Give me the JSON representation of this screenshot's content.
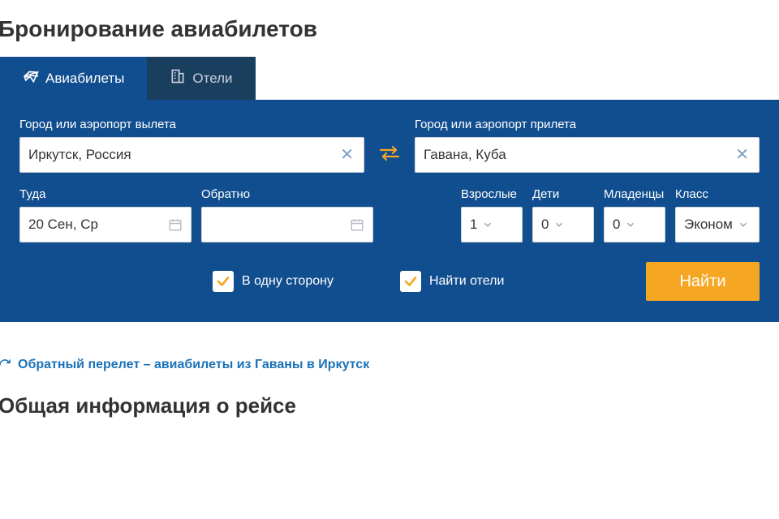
{
  "page_title": "Бронирование авиабилетов",
  "tabs": {
    "flights": "Авиабилеты",
    "hotels": "Отели"
  },
  "labels": {
    "from": "Город или аэропорт вылета",
    "to": "Город или аэропорт прилета",
    "depart": "Туда",
    "return": "Обратно",
    "adults": "Взрослые",
    "children": "Дети",
    "infants": "Младенцы",
    "class": "Класс"
  },
  "values": {
    "from": "Иркутск, Россия",
    "to": "Гавана, Куба",
    "depart": "20 Сен, Ср",
    "return": "",
    "adults": "1",
    "children": "0",
    "infants": "0",
    "class": "Эконом"
  },
  "checks": {
    "one_way": "В одну сторону",
    "find_hotels": "Найти отели"
  },
  "search_button": "Найти",
  "reverse_link": "Обратный перелет – авиабилеты из Гаваны в Иркутск",
  "section_title": "Общая информация о рейсе",
  "colors": {
    "panel": "#114e8f",
    "tab_inactive": "#1a3e5e",
    "accent": "#f5a623",
    "link": "#1b72b8"
  }
}
